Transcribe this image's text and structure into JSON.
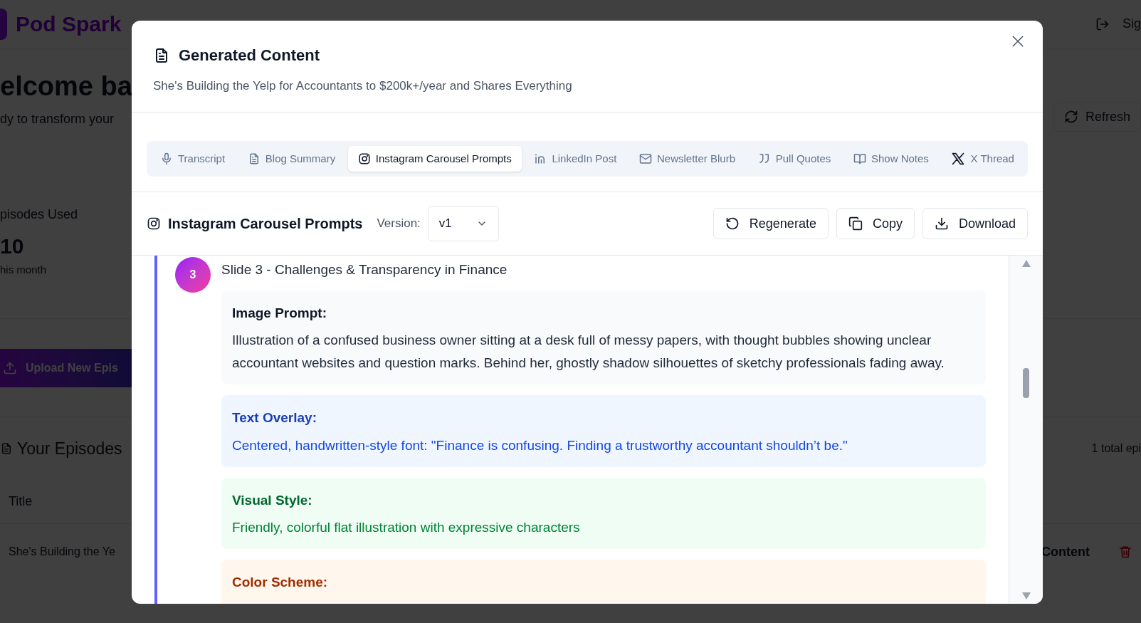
{
  "background": {
    "brand": "Pod Spark",
    "sign_out": "Sig",
    "heading": "elcome ba",
    "subheading": "dy to transform your",
    "stat": {
      "label": "pisodes Used",
      "value": "10",
      "note": "his month"
    },
    "upload_button": "Upload New Epis",
    "refresh_button": "Refresh",
    "episodes_title": "Your Episodes",
    "episodes_count": "1 total epi",
    "table": {
      "columns": [
        "Title"
      ],
      "rows": [
        {
          "title": "She's Building the Ye",
          "action": "Content"
        }
      ]
    }
  },
  "dialog": {
    "title": "Generated Content",
    "subtitle": "She's Building the Yelp for Accountants to $200k+/year and Shares Everything",
    "tabs": [
      {
        "label": "Transcript",
        "selected": false
      },
      {
        "label": "Blog Summary",
        "selected": false
      },
      {
        "label": "Instagram Carousel Prompts",
        "selected": true
      },
      {
        "label": "LinkedIn Post",
        "selected": false
      },
      {
        "label": "Newsletter Blurb",
        "selected": false
      },
      {
        "label": "Pull Quotes",
        "selected": false
      },
      {
        "label": "Show Notes",
        "selected": false
      },
      {
        "label": "X Thread",
        "selected": false
      }
    ],
    "toolbar": {
      "title": "Instagram Carousel Prompts",
      "version_label": "Version:",
      "version": "v1",
      "buttons": [
        "Regenerate",
        "Copy",
        "Download"
      ]
    },
    "slide": {
      "number": "3",
      "title": "Slide 3 - Challenges & Transparency in Finance",
      "sections": [
        {
          "kind": "image",
          "heading": "Image Prompt:",
          "text": "Illustration of a confused business owner sitting at a desk full of messy papers, with thought bubbles showing unclear accountant websites and question marks. Behind her, ghostly shadow silhouettes of sketchy professionals fading away."
        },
        {
          "kind": "overlay",
          "heading": "Text Overlay:",
          "text": "Centered, handwritten-style font: \"Finance is confusing. Finding a trustworthy accountant shouldn’t be.\""
        },
        {
          "kind": "style",
          "heading": "Visual Style:",
          "text": "Friendly, colorful flat illustration with expressive characters"
        },
        {
          "kind": "color",
          "heading": "Color Scheme:"
        }
      ]
    }
  }
}
